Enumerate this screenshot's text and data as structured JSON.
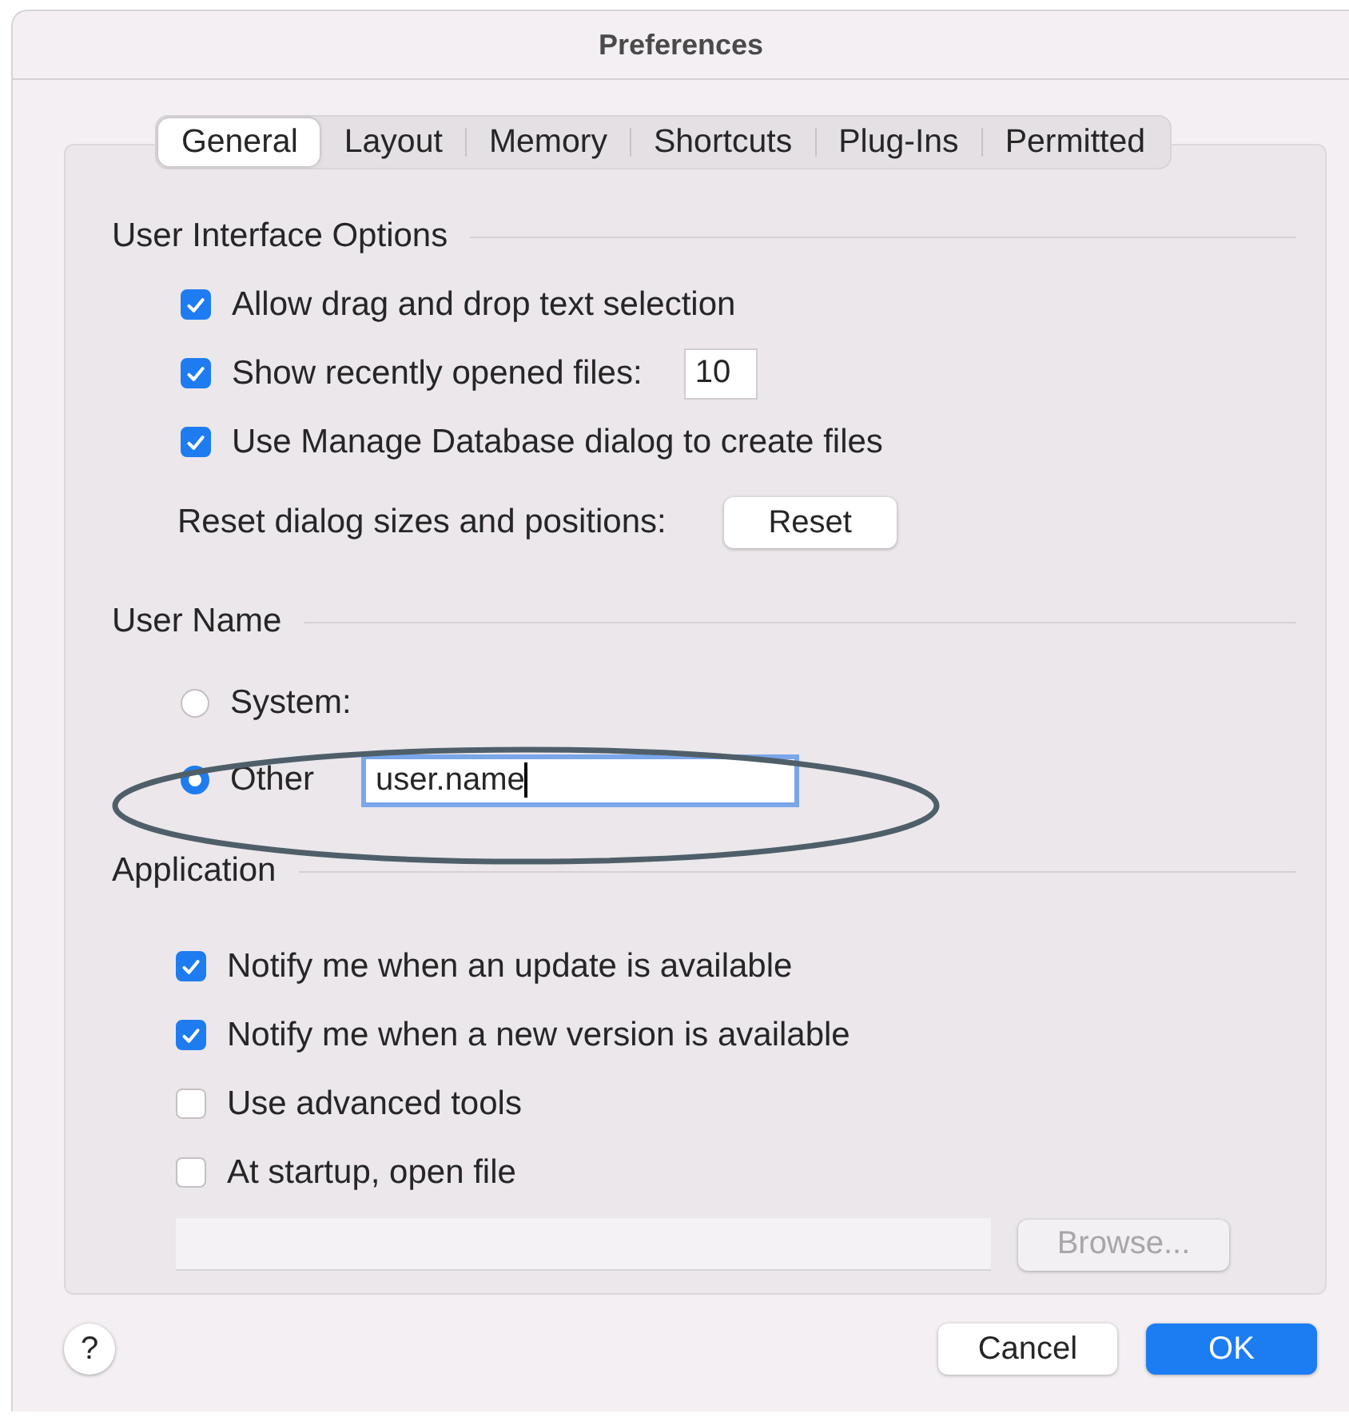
{
  "window": {
    "title": "Preferences"
  },
  "tabs": [
    {
      "label": "General",
      "selected": true
    },
    {
      "label": "Layout",
      "selected": false
    },
    {
      "label": "Memory",
      "selected": false
    },
    {
      "label": "Shortcuts",
      "selected": false
    },
    {
      "label": "Plug-Ins",
      "selected": false
    },
    {
      "label": "Permitted",
      "selected": false
    }
  ],
  "sections": [
    {
      "title": "User Interface Options",
      "items": [
        {
          "kind": "checkbox",
          "label": "Allow drag and drop text selection",
          "checked": true
        },
        {
          "kind": "checkbox",
          "label": "Show recently opened files:",
          "checked": true,
          "value": "10"
        },
        {
          "kind": "checkbox",
          "label": "Use Manage Database dialog to create files",
          "checked": true
        },
        {
          "kind": "action",
          "label": "Reset dialog sizes and positions:",
          "button": "Reset"
        }
      ]
    },
    {
      "title": "User Name",
      "items": [
        {
          "kind": "radio",
          "label": "System:",
          "selected": false
        },
        {
          "kind": "radio",
          "label": "Other",
          "selected": true,
          "value": "user.name",
          "focused": true,
          "circled": true
        }
      ]
    },
    {
      "title": "Application",
      "items": [
        {
          "kind": "checkbox",
          "label": "Notify me when an update is available",
          "checked": true
        },
        {
          "kind": "checkbox",
          "label": "Notify me when a new version is available",
          "checked": true
        },
        {
          "kind": "checkbox",
          "label": "Use advanced tools",
          "checked": false
        },
        {
          "kind": "checkbox",
          "label": "At startup, open file",
          "checked": false
        },
        {
          "kind": "file",
          "button": "Browse...",
          "disabled": true
        }
      ]
    }
  ],
  "help": "?",
  "buttons": [
    {
      "label": "Cancel",
      "default": false
    },
    {
      "label": "OK",
      "default": true
    }
  ]
}
